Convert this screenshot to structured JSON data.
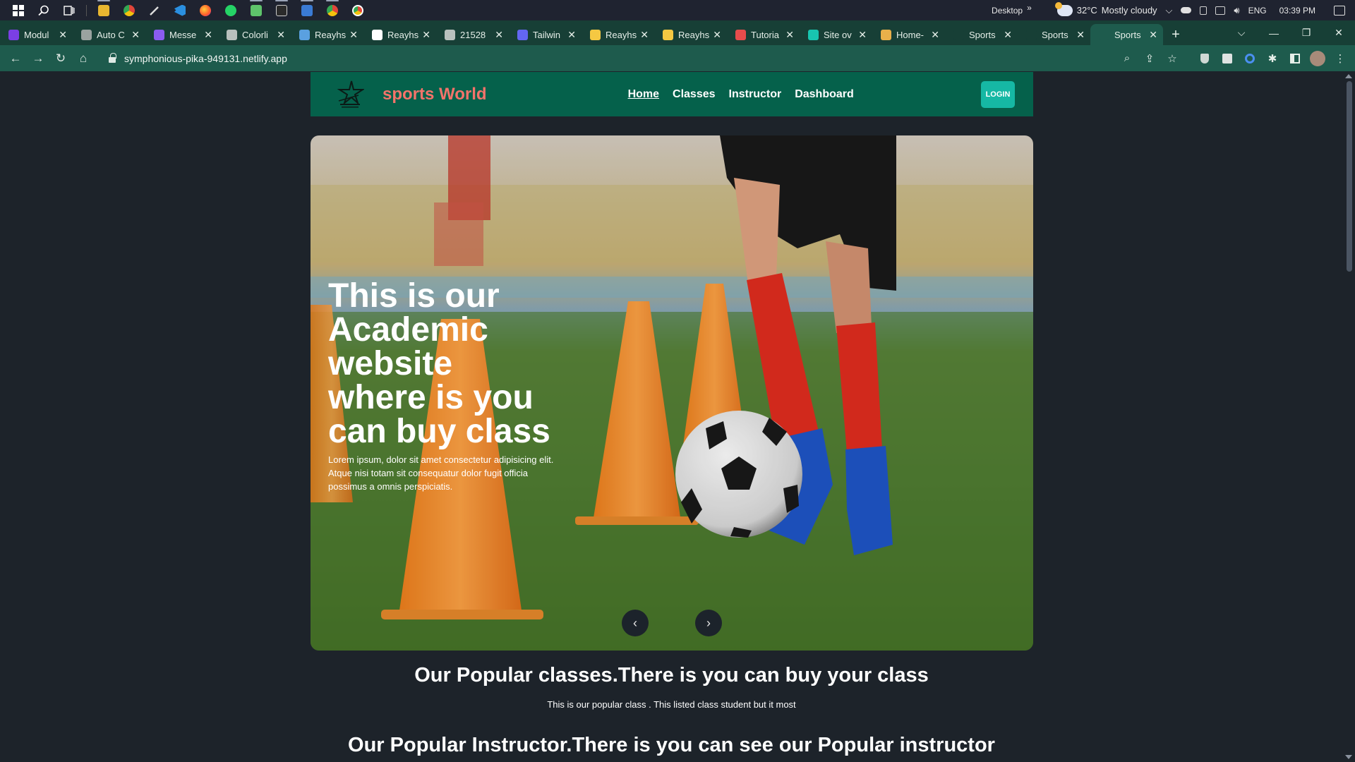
{
  "taskbar": {
    "apps": [
      "start",
      "search",
      "task-view",
      "file-explorer",
      "chrome",
      "pen-tool",
      "vscode",
      "firefox",
      "whatsapp",
      "android-studio",
      "terminal",
      "remote-desktop",
      "chrome-green",
      "chrome-alt"
    ],
    "desktop_label": "Desktop",
    "chevron": "»",
    "weather_temp": "32°C",
    "weather_text": "Mostly cloudy",
    "language": "ENG",
    "time": "03:39 PM"
  },
  "browser": {
    "tabs": [
      {
        "label": "Modul",
        "color": "#7b3fe4"
      },
      {
        "label": "Auto C",
        "color": "#9aa3a0"
      },
      {
        "label": "Messe",
        "color": "#8a5cf0"
      },
      {
        "label": "Colorli",
        "color": "#b8c0bd"
      },
      {
        "label": "Reayhs",
        "color": "#5aa0e0"
      },
      {
        "label": "Reayhs",
        "color": "#ffffff"
      },
      {
        "label": "21528",
        "color": "#b8c0bd"
      },
      {
        "label": "Tailwin",
        "color": "#6366f1"
      },
      {
        "label": "Reayhs",
        "color": "#f5c842"
      },
      {
        "label": "Reayhs",
        "color": "#f5c842"
      },
      {
        "label": "Tutoria",
        "color": "#e64c4c"
      },
      {
        "label": "Site ov",
        "color": "#18c5b0"
      },
      {
        "label": "Home-",
        "color": "#e9b04a"
      },
      {
        "label": "Sports",
        "color": "#173f36"
      },
      {
        "label": "Sports",
        "color": "#173f36"
      },
      {
        "label": "Sports",
        "color": "#1e5b4d"
      }
    ],
    "close_glyph": "✕",
    "new_tab_glyph": "+",
    "url": "symphonious-pika-949131.netlify.app"
  },
  "site": {
    "brand": "sports World",
    "nav": [
      "Home",
      "Classes",
      "Instructor",
      "Dashboard"
    ],
    "login": "LOGIN",
    "hero_title": "This is our Academic website where is you can buy class",
    "hero_desc": "Lorem ipsum, dolor sit amet consectetur adipisicing elit. Atque nisi totam sit consequatur dolor fugit officia possimus a omnis perspiciatis.",
    "prev_glyph": "‹",
    "next_glyph": "›",
    "popular_classes_title": "Our Popular classes.There is you can buy your class",
    "popular_classes_sub": "This is our popular class . This listed class student but it most",
    "popular_instructor_title": "Our Popular Instructor.There is you can see our Popular instructor"
  },
  "colors": {
    "page_bg": "#1d232a",
    "nav_bg": "#05614b",
    "brand": "#f4736a",
    "login_bg": "#16b8a4",
    "tabstrip_bg": "#173f36",
    "toolbar_bg": "#1e5b4d"
  }
}
